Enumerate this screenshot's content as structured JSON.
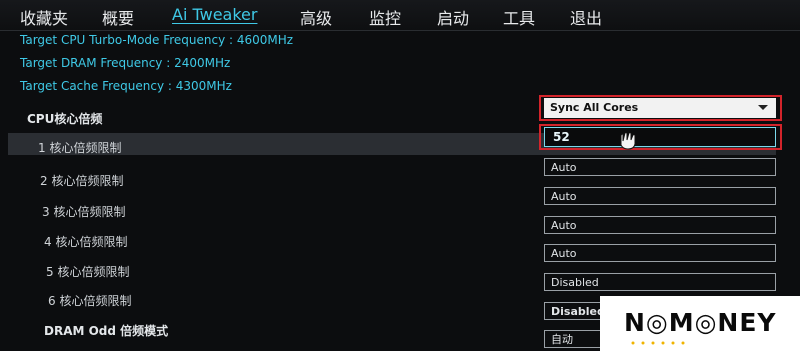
{
  "tabs": [
    {
      "label": "收藏夹"
    },
    {
      "label": "概要"
    },
    {
      "label": "Ai Tweaker"
    },
    {
      "label": "高级"
    },
    {
      "label": "监控"
    },
    {
      "label": "启动"
    },
    {
      "label": "工具"
    },
    {
      "label": "退出"
    }
  ],
  "info": {
    "cpu_turbo": "Target CPU Turbo-Mode Frequency : 4600MHz",
    "dram": "Target DRAM Frequency : 2400MHz",
    "cache": "Target Cache Frequency : 4300MHz"
  },
  "ratio": {
    "label": "CPU核心倍频",
    "selected": "Sync All Cores"
  },
  "cores": [
    {
      "label": "1 核心倍频限制",
      "value": "52"
    },
    {
      "label": "2 核心倍频限制",
      "value": "Auto"
    },
    {
      "label": "3 核心倍频限制",
      "value": "Auto"
    },
    {
      "label": "4 核心倍频限制",
      "value": "Auto"
    },
    {
      "label": "5 核心倍频限制",
      "value": "Auto"
    },
    {
      "label": "6 核心倍频限制",
      "value": "Disabled"
    }
  ],
  "dram_odd": {
    "label": "DRAM Odd 倍频模式",
    "value": "自动"
  },
  "watermark": {
    "text": "N◎M◎NEY"
  },
  "colors": {
    "accent": "#3fc9e6",
    "highlight": "#d3242b",
    "background": "#0c0d0f"
  }
}
